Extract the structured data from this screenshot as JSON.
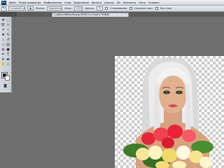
{
  "app": {
    "logo": "Ps"
  },
  "menu": [
    "Файл",
    "Редактирование",
    "Изображение",
    "Слои",
    "Выделение",
    "Фильтр",
    "Анализ",
    "3D",
    "Просмотр",
    "Окно",
    "Справка"
  ],
  "options_bar": {
    "tool_icon": "brush-icon",
    "preset": "Основной цвет",
    "mode_label": "Режим:",
    "mode_value": "Нормальный",
    "opacity_label": "Непр.:",
    "opacity_value": "100%",
    "tolerance_label": "Допуск:",
    "tolerance_value": "32",
    "antialias_label": "Сглаживание",
    "contiguous_label": "Смежные пикс.",
    "all_layers_label": "Все слои"
  },
  "document": {
    "tab_title": "1_bab1ccf865ac0b.png @ 66,7% (Слой 0, RGB/8)"
  },
  "colors": {
    "foreground": "#0a0c2a",
    "background": "#ffffff"
  }
}
